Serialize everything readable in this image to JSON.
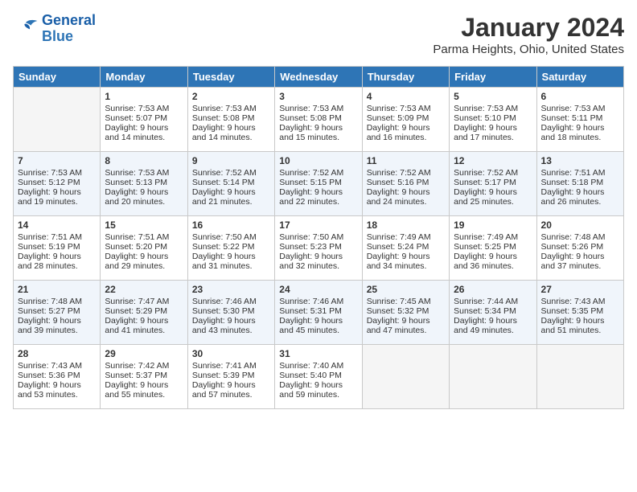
{
  "header": {
    "logo_line1": "General",
    "logo_line2": "Blue",
    "month_title": "January 2024",
    "location": "Parma Heights, Ohio, United States"
  },
  "days_of_week": [
    "Sunday",
    "Monday",
    "Tuesday",
    "Wednesday",
    "Thursday",
    "Friday",
    "Saturday"
  ],
  "weeks": [
    [
      {
        "day": "",
        "empty": true
      },
      {
        "day": "1",
        "sunrise": "7:53 AM",
        "sunset": "5:07 PM",
        "daylight": "9 hours and 14 minutes."
      },
      {
        "day": "2",
        "sunrise": "7:53 AM",
        "sunset": "5:08 PM",
        "daylight": "9 hours and 14 minutes."
      },
      {
        "day": "3",
        "sunrise": "7:53 AM",
        "sunset": "5:08 PM",
        "daylight": "9 hours and 15 minutes."
      },
      {
        "day": "4",
        "sunrise": "7:53 AM",
        "sunset": "5:09 PM",
        "daylight": "9 hours and 16 minutes."
      },
      {
        "day": "5",
        "sunrise": "7:53 AM",
        "sunset": "5:10 PM",
        "daylight": "9 hours and 17 minutes."
      },
      {
        "day": "6",
        "sunrise": "7:53 AM",
        "sunset": "5:11 PM",
        "daylight": "9 hours and 18 minutes."
      }
    ],
    [
      {
        "day": "7",
        "sunrise": "7:53 AM",
        "sunset": "5:12 PM",
        "daylight": "9 hours and 19 minutes."
      },
      {
        "day": "8",
        "sunrise": "7:53 AM",
        "sunset": "5:13 PM",
        "daylight": "9 hours and 20 minutes."
      },
      {
        "day": "9",
        "sunrise": "7:52 AM",
        "sunset": "5:14 PM",
        "daylight": "9 hours and 21 minutes."
      },
      {
        "day": "10",
        "sunrise": "7:52 AM",
        "sunset": "5:15 PM",
        "daylight": "9 hours and 22 minutes."
      },
      {
        "day": "11",
        "sunrise": "7:52 AM",
        "sunset": "5:16 PM",
        "daylight": "9 hours and 24 minutes."
      },
      {
        "day": "12",
        "sunrise": "7:52 AM",
        "sunset": "5:17 PM",
        "daylight": "9 hours and 25 minutes."
      },
      {
        "day": "13",
        "sunrise": "7:51 AM",
        "sunset": "5:18 PM",
        "daylight": "9 hours and 26 minutes."
      }
    ],
    [
      {
        "day": "14",
        "sunrise": "7:51 AM",
        "sunset": "5:19 PM",
        "daylight": "9 hours and 28 minutes."
      },
      {
        "day": "15",
        "sunrise": "7:51 AM",
        "sunset": "5:20 PM",
        "daylight": "9 hours and 29 minutes."
      },
      {
        "day": "16",
        "sunrise": "7:50 AM",
        "sunset": "5:22 PM",
        "daylight": "9 hours and 31 minutes."
      },
      {
        "day": "17",
        "sunrise": "7:50 AM",
        "sunset": "5:23 PM",
        "daylight": "9 hours and 32 minutes."
      },
      {
        "day": "18",
        "sunrise": "7:49 AM",
        "sunset": "5:24 PM",
        "daylight": "9 hours and 34 minutes."
      },
      {
        "day": "19",
        "sunrise": "7:49 AM",
        "sunset": "5:25 PM",
        "daylight": "9 hours and 36 minutes."
      },
      {
        "day": "20",
        "sunrise": "7:48 AM",
        "sunset": "5:26 PM",
        "daylight": "9 hours and 37 minutes."
      }
    ],
    [
      {
        "day": "21",
        "sunrise": "7:48 AM",
        "sunset": "5:27 PM",
        "daylight": "9 hours and 39 minutes."
      },
      {
        "day": "22",
        "sunrise": "7:47 AM",
        "sunset": "5:29 PM",
        "daylight": "9 hours and 41 minutes."
      },
      {
        "day": "23",
        "sunrise": "7:46 AM",
        "sunset": "5:30 PM",
        "daylight": "9 hours and 43 minutes."
      },
      {
        "day": "24",
        "sunrise": "7:46 AM",
        "sunset": "5:31 PM",
        "daylight": "9 hours and 45 minutes."
      },
      {
        "day": "25",
        "sunrise": "7:45 AM",
        "sunset": "5:32 PM",
        "daylight": "9 hours and 47 minutes."
      },
      {
        "day": "26",
        "sunrise": "7:44 AM",
        "sunset": "5:34 PM",
        "daylight": "9 hours and 49 minutes."
      },
      {
        "day": "27",
        "sunrise": "7:43 AM",
        "sunset": "5:35 PM",
        "daylight": "9 hours and 51 minutes."
      }
    ],
    [
      {
        "day": "28",
        "sunrise": "7:43 AM",
        "sunset": "5:36 PM",
        "daylight": "9 hours and 53 minutes."
      },
      {
        "day": "29",
        "sunrise": "7:42 AM",
        "sunset": "5:37 PM",
        "daylight": "9 hours and 55 minutes."
      },
      {
        "day": "30",
        "sunrise": "7:41 AM",
        "sunset": "5:39 PM",
        "daylight": "9 hours and 57 minutes."
      },
      {
        "day": "31",
        "sunrise": "7:40 AM",
        "sunset": "5:40 PM",
        "daylight": "9 hours and 59 minutes."
      },
      {
        "day": "",
        "empty": true
      },
      {
        "day": "",
        "empty": true
      },
      {
        "day": "",
        "empty": true
      }
    ]
  ],
  "labels": {
    "sunrise_prefix": "Sunrise: ",
    "sunset_prefix": "Sunset: ",
    "daylight_prefix": "Daylight: "
  }
}
